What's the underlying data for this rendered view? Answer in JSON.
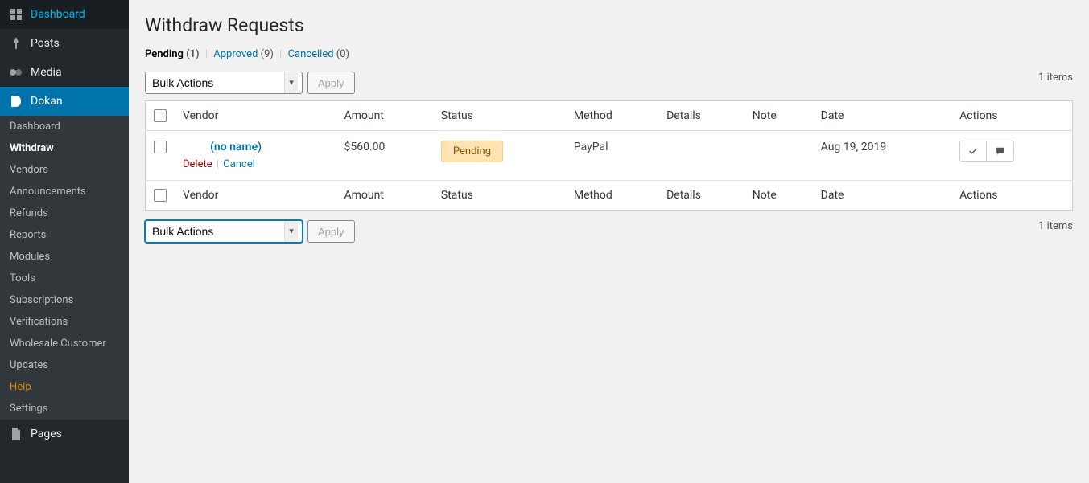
{
  "sidebar": {
    "items": [
      {
        "label": "Dashboard",
        "icon": "dashboard"
      },
      {
        "label": "Posts",
        "icon": "pin"
      },
      {
        "label": "Media",
        "icon": "media"
      },
      {
        "label": "Dokan",
        "icon": "dokan",
        "active": true
      },
      {
        "label": "Pages",
        "icon": "page"
      }
    ],
    "submenu": [
      {
        "label": "Dashboard"
      },
      {
        "label": "Withdraw",
        "active": true
      },
      {
        "label": "Vendors"
      },
      {
        "label": "Announcements"
      },
      {
        "label": "Refunds"
      },
      {
        "label": "Reports"
      },
      {
        "label": "Modules"
      },
      {
        "label": "Tools"
      },
      {
        "label": "Subscriptions"
      },
      {
        "label": "Verifications"
      },
      {
        "label": "Wholesale Customer"
      },
      {
        "label": "Updates"
      },
      {
        "label": "Help",
        "help": true
      },
      {
        "label": "Settings"
      }
    ]
  },
  "page": {
    "title": "Withdraw Requests",
    "tabs": [
      {
        "label": "Pending",
        "count": "(1)",
        "active": true
      },
      {
        "label": "Approved",
        "count": "(9)"
      },
      {
        "label": "Cancelled",
        "count": "(0)"
      }
    ],
    "bulkActions": {
      "selected": "Bulk Actions",
      "apply": "Apply"
    },
    "itemsCount": "1 items",
    "columns": [
      "Vendor",
      "Amount",
      "Status",
      "Method",
      "Details",
      "Note",
      "Date",
      "Actions"
    ],
    "rows": [
      {
        "vendor": "(no name)",
        "amount": "$560.00",
        "status": "Pending",
        "method": "PayPal",
        "details": "",
        "note": "",
        "date": "Aug 19, 2019",
        "rowActions": {
          "delete": "Delete",
          "cancel": "Cancel"
        }
      }
    ]
  }
}
